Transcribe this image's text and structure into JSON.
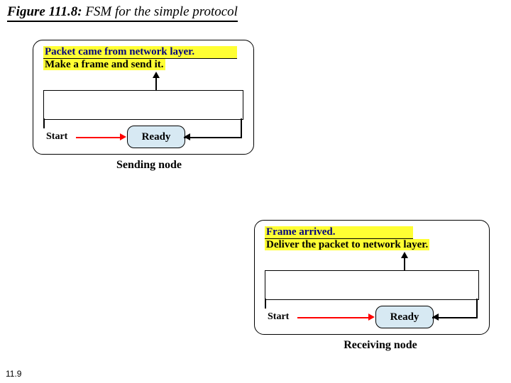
{
  "title_lead": "Figure 111.8:",
  "title_rest": "  FSM  for the simple protocol",
  "footer": "11.9",
  "sending": {
    "event_condition": "Packet came from network layer.",
    "event_action": "Make a frame and send it.",
    "start": "Start",
    "ready": "Ready",
    "caption": "Sending node"
  },
  "receiving": {
    "event_condition": "Frame arrived.",
    "event_action": "Deliver the packet to network layer.",
    "start": "Start",
    "ready": "Ready",
    "caption": "Receiving node"
  }
}
